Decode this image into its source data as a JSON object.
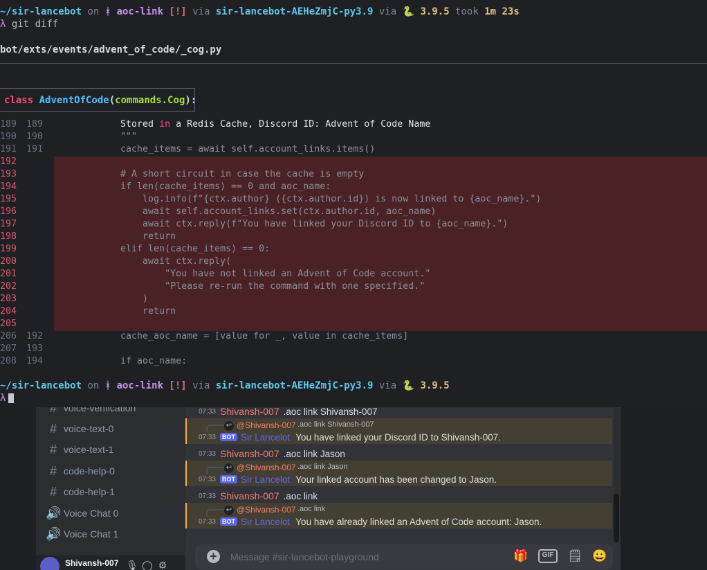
{
  "terminal": {
    "prompt1": {
      "path": "~/sir-lancebot",
      "on": " on ",
      "branch_icon": "ᚼ",
      "branch": " aoc-link",
      "status": " [!]",
      "via1": " via ",
      "env": "sir-lancebot-AEHeZmjC-py3.9",
      "via2": " via ",
      "py_icon": "🐍",
      "py": " 3.9.5",
      "took": " took ",
      "duration": "1m 23s"
    },
    "command_line": {
      "prompt_char": "λ",
      "command": " git diff"
    },
    "filename": "bot/exts/events/advent_of_code/_cog.py",
    "hunk": {
      "kw": "class",
      "name": "AdventOfCode",
      "open": "(",
      "arg": "commands.Cog",
      "close": "):"
    },
    "lines": [
      {
        "old": "189",
        "new": "189",
        "text": "    Stored in a Redis Cache, Discord ID: Advent of Code Name"
      },
      {
        "old": "190",
        "new": "190",
        "text": "    \"\"\""
      },
      {
        "old": "191",
        "new": "191",
        "text": "    cache_items = await self.account_links.items()"
      },
      {
        "old": "192",
        "new": "",
        "text": ""
      },
      {
        "old": "193",
        "new": "",
        "text": "    # A short circuit in case the cache is empty"
      },
      {
        "old": "194",
        "new": "",
        "text": "    if len(cache_items) == 0 and aoc_name:"
      },
      {
        "old": "195",
        "new": "",
        "text": "        log.info(f\"{ctx.author} ({ctx.author.id}) is now linked to {aoc_name}.\")"
      },
      {
        "old": "196",
        "new": "",
        "text": "        await self.account_links.set(ctx.author.id, aoc_name)"
      },
      {
        "old": "197",
        "new": "",
        "text": "        await ctx.reply(f\"You have linked your Discord ID to {aoc_name}.\")"
      },
      {
        "old": "198",
        "new": "",
        "text": "        return"
      },
      {
        "old": "199",
        "new": "",
        "text": "    elif len(cache_items) == 0:"
      },
      {
        "old": "200",
        "new": "",
        "text": "        await ctx.reply("
      },
      {
        "old": "201",
        "new": "",
        "text": "            \"You have not linked an Advent of Code account.\""
      },
      {
        "old": "202",
        "new": "",
        "text": "            \"Please re-run the command with one specified.\""
      },
      {
        "old": "203",
        "new": "",
        "text": "        )"
      },
      {
        "old": "204",
        "new": "",
        "text": "        return"
      },
      {
        "old": "205",
        "new": "",
        "text": ""
      },
      {
        "old": "206",
        "new": "192",
        "text": "    cache_aoc_name = [value for _, value in cache_items]"
      },
      {
        "old": "207",
        "new": "193",
        "text": ""
      },
      {
        "old": "208",
        "new": "194",
        "text": "    if aoc_name:"
      }
    ],
    "prompt2": {
      "path": "~/sir-lancebot",
      "on": " on ",
      "branch_icon": "ᚼ",
      "branch": " aoc-link",
      "status": " [!]",
      "via1": " via ",
      "env": "sir-lancebot-AEHeZmjC-py3.9",
      "via2": " via ",
      "py_icon": "🐍",
      "py": " 3.9.5"
    },
    "prompt_char": "λ"
  },
  "discord": {
    "channels": [
      {
        "icon": "#",
        "name": "voice-verification"
      },
      {
        "icon": "#",
        "name": "voice-text-0"
      },
      {
        "icon": "#",
        "name": "voice-text-1"
      },
      {
        "icon": "#",
        "name": "code-help-0"
      },
      {
        "icon": "#",
        "name": "code-help-1"
      },
      {
        "icon": "🔊",
        "name": "Voice Chat 0"
      },
      {
        "icon": "🔊",
        "name": "Voice Chat 1"
      }
    ],
    "user": {
      "name": "Shivansh-007"
    },
    "messages": [
      {
        "time": "07:33",
        "author": "Shivansh-007",
        "text": ".aoc link Shivansh-007"
      },
      {
        "reply_to": "@Shivansh-007",
        "reply_text": ".aoc link Shivansh-007",
        "time": "07:33",
        "badge": "BOT",
        "author": "Sir Lancelot",
        "text": "You have linked your Discord ID to Shivansh-007."
      },
      {
        "time": "07:33",
        "author": "Shivansh-007",
        "text": ".aoc link Jason"
      },
      {
        "reply_to": "@Shivansh-007",
        "reply_text": ".aoc link Jason",
        "time": "07:33",
        "badge": "BOT",
        "author": "Sir Lancelot",
        "text": "Your linked account has been changed to Jason."
      },
      {
        "time": "07:33",
        "author": "Shivansh-007",
        "text": ".aoc link"
      },
      {
        "reply_to": "@Shivansh-007",
        "reply_text": ".aoc link",
        "time": "07:33",
        "badge": "BOT",
        "author": "Sir Lancelot",
        "text": "You have already linked an Advent of Code account: Jason."
      }
    ],
    "composer": {
      "placeholder": "Message #sir-lancebot-playground"
    },
    "composer_icons": {
      "gift": "🎁",
      "gif": "GIF",
      "sticker": "🗒",
      "emoji": "😀"
    },
    "colors": {
      "diff_removed_bg": "#4a2225",
      "mention_bg": "#443f33",
      "mention_border": "#f0b232",
      "bot_badge": "#5865f2"
    }
  }
}
